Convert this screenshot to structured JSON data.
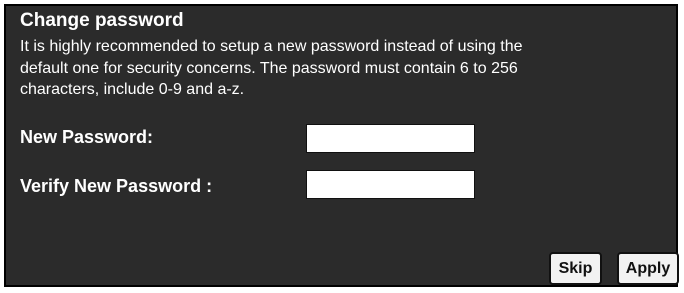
{
  "panel": {
    "title": "Change password",
    "description_lines": [
      "It is highly recommended to setup a new password instead of using the",
      "default one for security concerns. The password must contain 6 to 256",
      "characters, include 0-9 and a-z."
    ]
  },
  "form": {
    "new_password_label": "New Password:",
    "new_password_value": "",
    "verify_password_label": "Verify New Password :",
    "verify_password_value": ""
  },
  "buttons": {
    "skip_label": "Skip",
    "apply_label": "Apply"
  },
  "colors": {
    "panel_background": "#2b2b2b",
    "panel_text": "#ffffff",
    "button_background": "#f2f2f2"
  }
}
